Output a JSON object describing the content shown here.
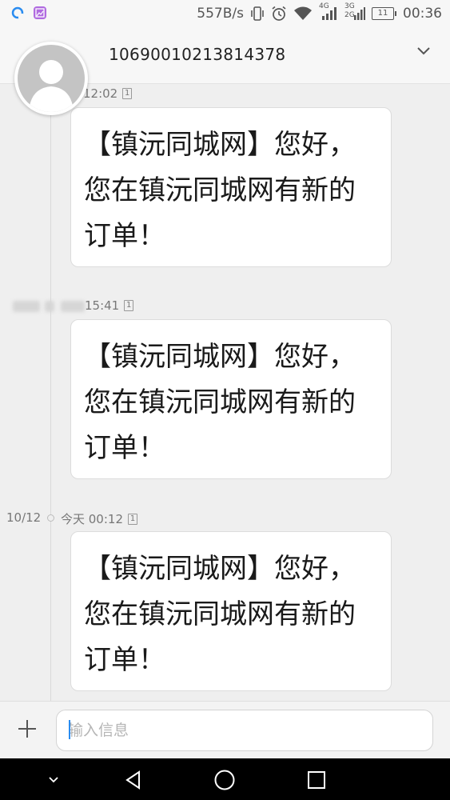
{
  "status_bar": {
    "net_speed": "557B/s",
    "network_4g": "4G",
    "network_3g": "3G",
    "network_2g": "2G",
    "battery": "11",
    "time": "00:36"
  },
  "header": {
    "contact": "10690010213814378"
  },
  "messages": [
    {
      "time": "12:02",
      "date": "",
      "sim": "1",
      "text": "【镇沅同城网】您好，您在镇沅同城网有新的订单！"
    },
    {
      "time": "15:41",
      "date": "",
      "sim": "1",
      "text": "【镇沅同城网】您好，您在镇沅同城网有新的订单！"
    },
    {
      "time": "今天 00:12",
      "date": "10/12",
      "sim": "1",
      "text": "【镇沅同城网】您好，您在镇沅同城网有新的订单！"
    }
  ],
  "input": {
    "placeholder": "输入信息"
  },
  "colors": {
    "accent": "#2a8cf0",
    "bubble_bg": "#ffffff",
    "background": "#efefef"
  }
}
